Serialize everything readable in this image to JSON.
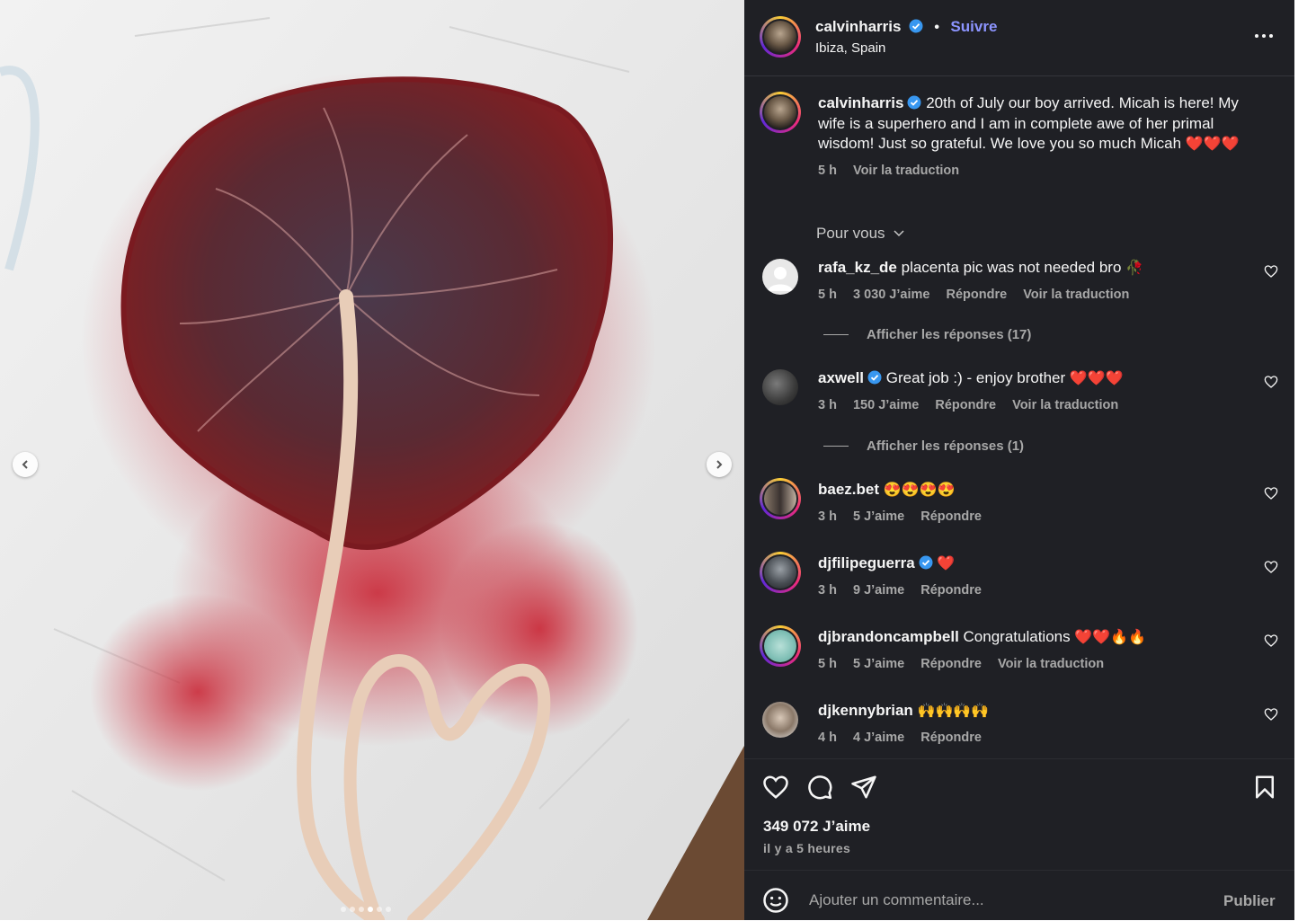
{
  "post": {
    "author": "calvinharris",
    "follow_label": "Suivre",
    "separator": "•",
    "location": "Ibiza, Spain"
  },
  "caption": {
    "username": "calvinharris",
    "text": "20th of July our boy arrived. Micah is here! My wife is a superhero and I am in complete awe of her primal wisdom! Just so grateful. We love you so much Micah",
    "emoji": "❤️❤️❤️",
    "time": "5 h",
    "translate": "Voir la traduction"
  },
  "sort_label": "Pour vous",
  "comments": [
    {
      "username": "rafa_kz_de",
      "text": "placenta pic was not needed bro",
      "emoji": "🥀",
      "time": "5 h",
      "likes": "3 030 J’aime",
      "reply": "Répondre",
      "translate": "Voir la traduction",
      "replies": "Afficher les réponses (17)"
    },
    {
      "username": "axwell",
      "text": "Great job :) - enjoy brother",
      "emoji": "❤️❤️❤️",
      "time": "3 h",
      "likes": "150 J’aime",
      "reply": "Répondre",
      "translate": "Voir la traduction",
      "replies": "Afficher les réponses (1)"
    },
    {
      "username": "baez.bet",
      "text": "",
      "emoji": "😍😍😍😍",
      "time": "3 h",
      "likes": "5 J’aime",
      "reply": "Répondre"
    },
    {
      "username": "djfilipeguerra",
      "text": "",
      "emoji": "❤️",
      "time": "3 h",
      "likes": "9 J’aime",
      "reply": "Répondre"
    },
    {
      "username": "djbrandoncampbell",
      "text": "Congratulations",
      "emoji": "❤️❤️🔥🔥",
      "time": "5 h",
      "likes": "5 J’aime",
      "reply": "Répondre",
      "translate": "Voir la traduction"
    },
    {
      "username": "djkennybrian",
      "text": "",
      "emoji": "🙌🙌🙌🙌",
      "time": "4 h",
      "likes": "4 J’aime",
      "reply": "Répondre"
    }
  ],
  "footer": {
    "likes": "349 072 J’aime",
    "ago": "il y a 5 heures",
    "comment_placeholder": "Ajouter un commentaire...",
    "publish": "Publier"
  },
  "icons": {
    "like": "heart-icon",
    "comment": "comment-bubble-icon",
    "share": "paper-plane-icon",
    "save": "bookmark-icon",
    "emoji": "smiley-icon",
    "more": "ellipsis-icon",
    "prev": "chevron-left-icon",
    "next": "chevron-right-icon",
    "verified": "verified-badge-icon"
  },
  "colors": {
    "panel_bg": "#1f2025",
    "follow": "#8c94ff",
    "verified": "#3897f0",
    "muted": "#a8a8a8"
  },
  "carousel": {
    "count": 6,
    "active": 4
  }
}
